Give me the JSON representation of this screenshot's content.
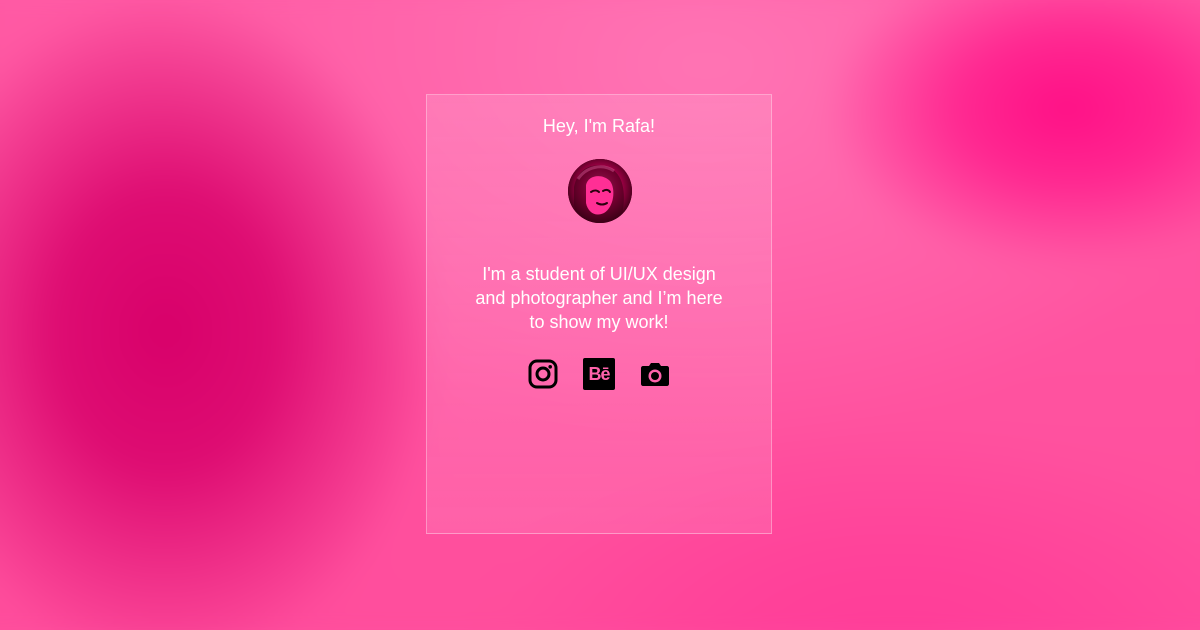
{
  "profile": {
    "title": "Hey, I'm Rafa!",
    "bio": "I'm a student of UI/UX design\nand photographer and I’m here\nto show my work!",
    "avatar_alt": "avatar"
  },
  "socials": {
    "items": [
      {
        "name": "instagram-icon"
      },
      {
        "name": "behance-icon",
        "label": "Bē"
      },
      {
        "name": "camera-icon"
      }
    ]
  },
  "colors": {
    "accent": "#ff4d9c",
    "card_border": "#ffffff",
    "text": "#ffffff",
    "icon": "#000000"
  }
}
